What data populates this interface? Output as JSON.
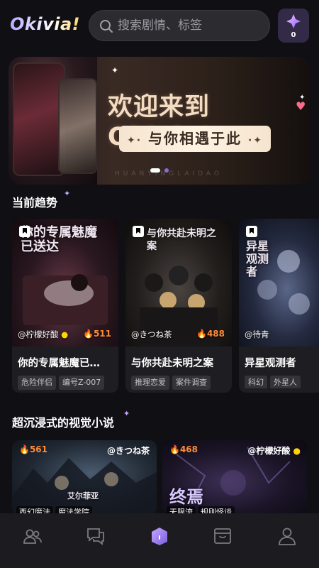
{
  "header": {
    "logo": "Okivia!",
    "search_placeholder": "搜索剧情、标签",
    "gem_count": "0"
  },
  "banner": {
    "title": "欢迎来到Okivia!",
    "subtitle": "与你相遇于此",
    "watermark": "HUANYINGLAIDAO"
  },
  "sections": {
    "trending": "当前趋势",
    "immersive": "超沉浸式的视觉小说"
  },
  "trending": [
    {
      "author": "@柠檬好酸",
      "heat": "511",
      "title": "你的专属魅魔已…",
      "tags": [
        "危险伴侣",
        "编号Z-007"
      ],
      "cover_text": "你的专属魅魔已送达",
      "author_icon": "lemon-icon"
    },
    {
      "author": "@きつね茶",
      "heat": "488",
      "title": "与你共赴未明之案",
      "tags": [
        "推理恋爱",
        "案件调查"
      ],
      "cover_text": "与你共赴未明之案"
    },
    {
      "author": "@待青",
      "heat": "",
      "title": "异星观测者",
      "tags": [
        "科幻",
        "外星人"
      ],
      "cover_text": "异星观测者"
    }
  ],
  "immersive": [
    {
      "heat": "561",
      "author": "@きつね茶",
      "tags": [
        "西幻魔法",
        "魔法学院"
      ],
      "cover_text": "艾尔菲亚"
    },
    {
      "heat": "468",
      "author": "@柠檬好酸",
      "tags": [
        "无限流",
        "规则怪谈"
      ],
      "cover_text": "终焉"
    }
  ],
  "nav": [
    "people-icon",
    "chat-icon",
    "home-icon",
    "inbox-icon",
    "profile-icon"
  ],
  "colors": {
    "accent": "#8a6bd8",
    "heat": "#ff8c3a",
    "background": "#0f0f14"
  }
}
